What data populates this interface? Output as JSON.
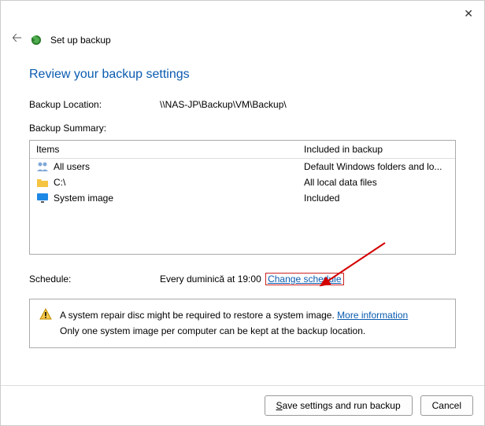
{
  "window": {
    "title": "Set up backup"
  },
  "heading": "Review your backup settings",
  "backup_location": {
    "label": "Backup Location:",
    "value": "\\\\NAS-JP\\Backup\\VM\\Backup\\"
  },
  "summary": {
    "label": "Backup Summary:",
    "headers": {
      "items": "Items",
      "included": "Included in backup"
    },
    "rows": [
      {
        "icon": "users",
        "item": "All users",
        "included": "Default Windows folders and lo..."
      },
      {
        "icon": "drive",
        "item": "C:\\",
        "included": "All local data files"
      },
      {
        "icon": "monitor",
        "item": "System image",
        "included": "Included"
      }
    ]
  },
  "schedule": {
    "label": "Schedule:",
    "value": "Every duminică at 19:00",
    "change_link": "Change schedule"
  },
  "info": {
    "line1_prefix": "A system repair disc might be required to restore a system image. ",
    "line1_link": "More information",
    "line2": "Only one system image per computer can be kept at the backup location."
  },
  "footer": {
    "save": "Save settings and run backup",
    "cancel": "Cancel"
  }
}
